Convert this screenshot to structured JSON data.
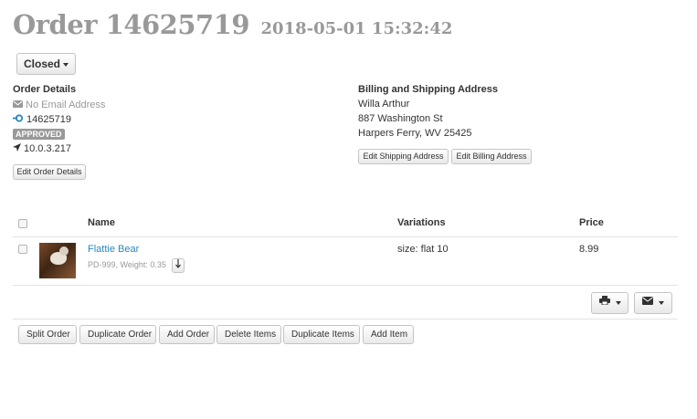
{
  "header": {
    "order_title": "Order 14625719",
    "order_date": "2018-05-01 15:32:42"
  },
  "status_button": {
    "label": "Closed",
    "icon": "caret-down-icon"
  },
  "order_details": {
    "heading": "Order Details",
    "email": "No Email Address",
    "order_id": "14625719",
    "status_badge": "APPROVED",
    "ip_address": "10.0.3.217",
    "edit_button": "Edit Order Details",
    "icons": [
      "envelope-icon",
      "link-icon",
      "location-arrow-icon"
    ]
  },
  "address": {
    "heading": "Billing and Shipping Address",
    "name": "Willa Arthur",
    "street": "887 Washington St",
    "city_state_zip": "Harpers Ferry, WV 25425",
    "edit_shipping_button": "Edit Shipping Address",
    "edit_billing_button": "Edit Billing Address"
  },
  "items_table": {
    "columns": [
      "Name",
      "Variations",
      "Price"
    ],
    "rows": [
      {
        "name": "Flattie Bear",
        "meta": "PD-999, Weight: 0.35",
        "variation": "size: flat 10",
        "price": "8.99"
      }
    ]
  },
  "toolbar": {
    "print_icon": "print-icon",
    "email_icon": "envelope-icon"
  },
  "actions": {
    "split_order": "Split Order",
    "duplicate_order": "Duplicate Order",
    "add_order": "Add Order",
    "delete_items": "Delete Items",
    "duplicate_items": "Duplicate Items",
    "add_item": "Add Item"
  },
  "colors": {
    "title_gray": "#999999",
    "link_blue": "#2a86c0",
    "badge_gray": "#999999"
  }
}
